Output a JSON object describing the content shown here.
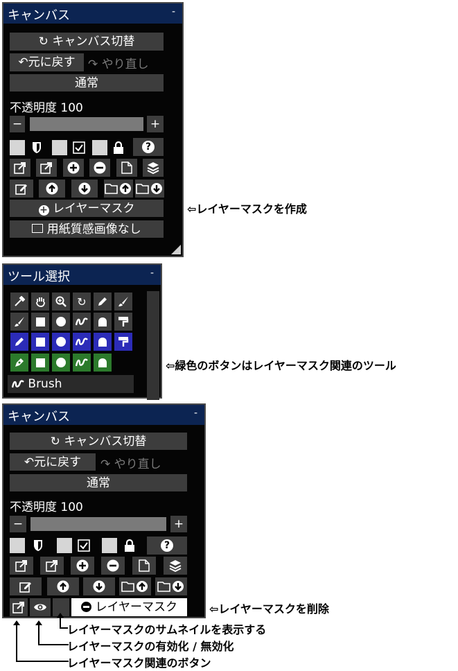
{
  "canvas_panel": {
    "title": "キャンバス",
    "minimize": "-",
    "switch_canvas": "キャンバス切替",
    "undo": "元に戻す",
    "redo": "やり直し",
    "blend_mode": "通常",
    "opacity_label": "不透明度 100",
    "opacity_minus": "−",
    "opacity_plus": "+",
    "help": "?",
    "layer_mask_button": "レイヤーマスク",
    "paper_texture": "用紙質感画像なし"
  },
  "tool_panel": {
    "title": "ツール選択",
    "minimize": "-",
    "current_tool": "Brush"
  },
  "canvas_panel_mask": {
    "title": "キャンバス",
    "minimize": "-",
    "switch_canvas": "キャンバス切替",
    "undo": "元に戻す",
    "redo": "やり直し",
    "blend_mode": "通常",
    "opacity_label": "不透明度 100",
    "opacity_minus": "−",
    "opacity_plus": "+",
    "help": "?",
    "layer_mask_button": "レイヤーマスク"
  },
  "annotations": {
    "create_mask": "⇦レイヤーマスクを作成",
    "green_buttons": "⇦緑色のボタンはレイヤーマスク関連のツール",
    "delete_mask": "⇦レイヤーマスクを削除",
    "thumbnail": "レイヤーマスクのサムネイルを表示する",
    "enable_disable": "レイヤーマスクの有効化 / 無効化",
    "related_button": "レイヤーマスク関連のボタン"
  },
  "colors": {
    "panel_bg": "#050505",
    "titlebar": "#0c2452",
    "button_gray": "#3d3d3d",
    "highlight_blue": "#2c2cb8",
    "mask_green": "#2c7a2c"
  }
}
